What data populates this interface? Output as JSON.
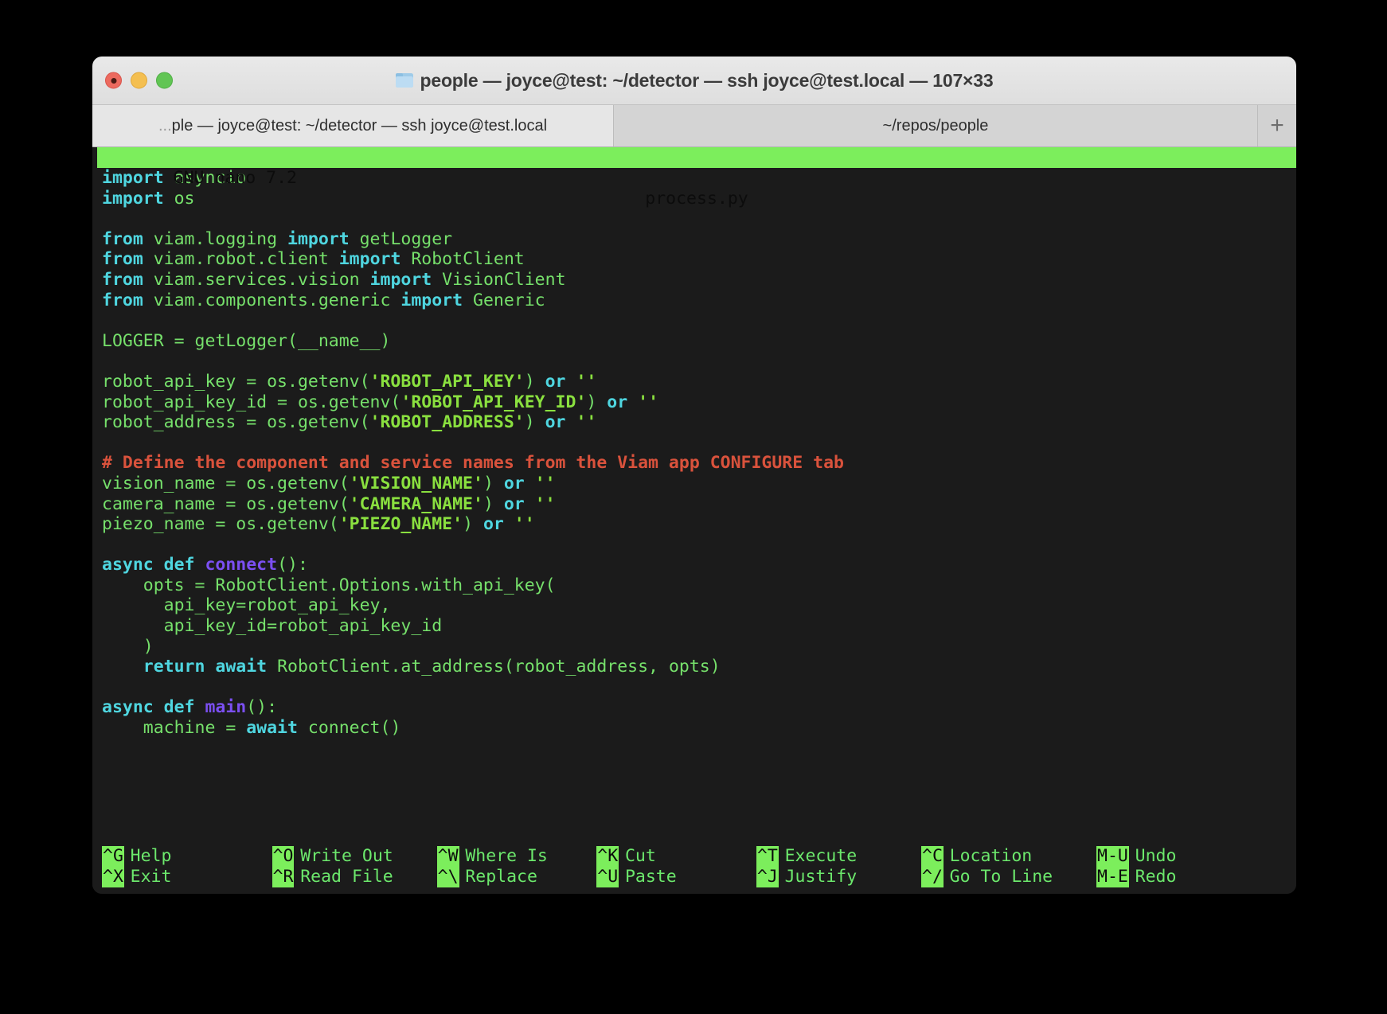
{
  "window": {
    "title": "people — joyce@test: ~/detector — ssh joyce@test.local — 107×33",
    "folder_icon": "folder-icon",
    "traffic_lights": {
      "close": "close-button",
      "minimize": "minimize-button",
      "maximize": "maximize-button"
    }
  },
  "tabs": {
    "active": {
      "ellipsis": "...",
      "label": "ple — joyce@test: ~/detector — ssh joyce@test.local"
    },
    "second": {
      "label": "~/repos/people"
    },
    "new_tab_label": "+"
  },
  "nano": {
    "version_label": "GNU nano 7.2",
    "filename": "process.py",
    "colors": {
      "titlebar_bg": "#7cee5c",
      "titlebar_fg": "#0c0c0c",
      "terminal_bg": "#1b1b1b",
      "keyword": "#4fd6e0",
      "identifier": "#76e06b",
      "string": "#8ae03f",
      "function": "#7b4ff2",
      "comment": "#d9523c"
    },
    "code_lines": [
      [
        {
          "t": "import",
          "c": "kw"
        },
        {
          "t": " asyncio",
          "c": "id"
        }
      ],
      [
        {
          "t": "import",
          "c": "kw"
        },
        {
          "t": " os",
          "c": "id"
        }
      ],
      [],
      [
        {
          "t": "from",
          "c": "kw"
        },
        {
          "t": " viam.logging ",
          "c": "id"
        },
        {
          "t": "import",
          "c": "kw"
        },
        {
          "t": " getLogger",
          "c": "id"
        }
      ],
      [
        {
          "t": "from",
          "c": "kw"
        },
        {
          "t": " viam.robot.client ",
          "c": "id"
        },
        {
          "t": "import",
          "c": "kw"
        },
        {
          "t": " RobotClient",
          "c": "id"
        }
      ],
      [
        {
          "t": "from",
          "c": "kw"
        },
        {
          "t": " viam.services.vision ",
          "c": "id"
        },
        {
          "t": "import",
          "c": "kw"
        },
        {
          "t": " VisionClient",
          "c": "id"
        }
      ],
      [
        {
          "t": "from",
          "c": "kw"
        },
        {
          "t": " viam.components.generic ",
          "c": "id"
        },
        {
          "t": "import",
          "c": "kw"
        },
        {
          "t": " Generic",
          "c": "id"
        }
      ],
      [],
      [
        {
          "t": "LOGGER = getLogger(__name__)",
          "c": "id"
        }
      ],
      [],
      [
        {
          "t": "robot_api_key = os.getenv(",
          "c": "id"
        },
        {
          "t": "'ROBOT_API_KEY'",
          "c": "str"
        },
        {
          "t": ") ",
          "c": "id"
        },
        {
          "t": "or",
          "c": "kw"
        },
        {
          "t": " ",
          "c": "id"
        },
        {
          "t": "''",
          "c": "str"
        }
      ],
      [
        {
          "t": "robot_api_key_id = os.getenv(",
          "c": "id"
        },
        {
          "t": "'ROBOT_API_KEY_ID'",
          "c": "str"
        },
        {
          "t": ") ",
          "c": "id"
        },
        {
          "t": "or",
          "c": "kw"
        },
        {
          "t": " ",
          "c": "id"
        },
        {
          "t": "''",
          "c": "str"
        }
      ],
      [
        {
          "t": "robot_address = os.getenv(",
          "c": "id"
        },
        {
          "t": "'ROBOT_ADDRESS'",
          "c": "str"
        },
        {
          "t": ") ",
          "c": "id"
        },
        {
          "t": "or",
          "c": "kw"
        },
        {
          "t": " ",
          "c": "id"
        },
        {
          "t": "''",
          "c": "str"
        }
      ],
      [],
      [
        {
          "t": "# Define the component and service names from the Viam app CONFIGURE tab",
          "c": "cmt"
        }
      ],
      [
        {
          "t": "vision_name = os.getenv(",
          "c": "id"
        },
        {
          "t": "'VISION_NAME'",
          "c": "str"
        },
        {
          "t": ") ",
          "c": "id"
        },
        {
          "t": "or",
          "c": "kw"
        },
        {
          "t": " ",
          "c": "id"
        },
        {
          "t": "''",
          "c": "str"
        }
      ],
      [
        {
          "t": "camera_name = os.getenv(",
          "c": "id"
        },
        {
          "t": "'CAMERA_NAME'",
          "c": "str"
        },
        {
          "t": ") ",
          "c": "id"
        },
        {
          "t": "or",
          "c": "kw"
        },
        {
          "t": " ",
          "c": "id"
        },
        {
          "t": "''",
          "c": "str"
        }
      ],
      [
        {
          "t": "piezo_name = os.getenv(",
          "c": "id"
        },
        {
          "t": "'PIEZO_NAME'",
          "c": "str"
        },
        {
          "t": ") ",
          "c": "id"
        },
        {
          "t": "or",
          "c": "kw"
        },
        {
          "t": " ",
          "c": "id"
        },
        {
          "t": "''",
          "c": "str"
        }
      ],
      [],
      [
        {
          "t": "async def ",
          "c": "kw"
        },
        {
          "t": "connect",
          "c": "fn"
        },
        {
          "t": "():",
          "c": "id"
        }
      ],
      [
        {
          "t": "    opts = RobotClient.Options.with_api_key(",
          "c": "id"
        }
      ],
      [
        {
          "t": "      api_key=robot_api_key,",
          "c": "id"
        }
      ],
      [
        {
          "t": "      api_key_id=robot_api_key_id",
          "c": "id"
        }
      ],
      [
        {
          "t": "    )",
          "c": "id"
        }
      ],
      [
        {
          "t": "    ",
          "c": "id"
        },
        {
          "t": "return await",
          "c": "kw"
        },
        {
          "t": " RobotClient.at_address(robot_address, opts)",
          "c": "id"
        }
      ],
      [],
      [
        {
          "t": "async def ",
          "c": "kw"
        },
        {
          "t": "main",
          "c": "fn"
        },
        {
          "t": "():",
          "c": "id"
        }
      ],
      [
        {
          "t": "    machine = ",
          "c": "id"
        },
        {
          "t": "await",
          "c": "kw"
        },
        {
          "t": " connect()",
          "c": "id"
        }
      ]
    ],
    "help_rows": [
      [
        {
          "key": "^G",
          "label": "Help"
        },
        {
          "key": "^O",
          "label": "Write Out"
        },
        {
          "key": "^W",
          "label": "Where Is"
        },
        {
          "key": "^K",
          "label": "Cut"
        },
        {
          "key": "^T",
          "label": "Execute"
        },
        {
          "key": "^C",
          "label": "Location"
        },
        {
          "key": "M-U",
          "label": "Undo"
        }
      ],
      [
        {
          "key": "^X",
          "label": "Exit"
        },
        {
          "key": "^R",
          "label": "Read File"
        },
        {
          "key": "^\\",
          "label": "Replace"
        },
        {
          "key": "^U",
          "label": "Paste"
        },
        {
          "key": "^J",
          "label": "Justify"
        },
        {
          "key": "^/",
          "label": "Go To Line"
        },
        {
          "key": "M-E",
          "label": "Redo"
        }
      ]
    ]
  }
}
